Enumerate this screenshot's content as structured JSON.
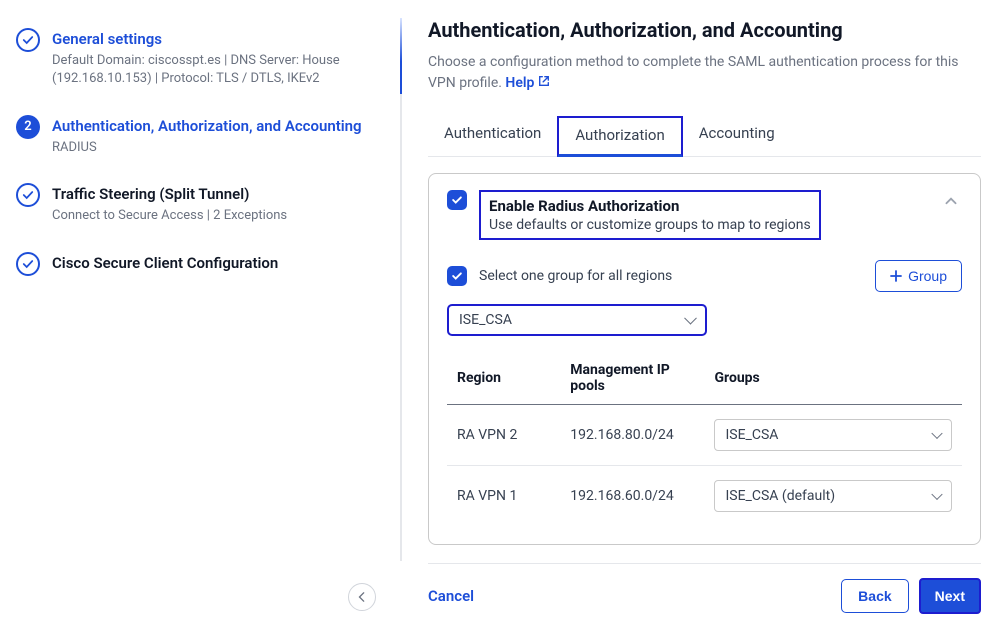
{
  "sidebar": {
    "steps": [
      {
        "title": "General settings",
        "sub": "Default Domain: ciscosspt.es | DNS Server: House (192.168.10.153) | Protocol: TLS / DTLS, IKEv2"
      },
      {
        "title": "Authentication, Authorization, and Accounting",
        "sub": "RADIUS",
        "num": "2"
      },
      {
        "title": "Traffic Steering (Split Tunnel)",
        "sub": "Connect to Secure Access | 2 Exceptions"
      },
      {
        "title": "Cisco Secure Client Configuration",
        "sub": ""
      }
    ]
  },
  "main": {
    "title": "Authentication, Authorization, and Accounting",
    "desc": "Choose a configuration method to complete the SAML authentication process for this VPN profile.",
    "help": "Help",
    "tabs": {
      "auth": "Authentication",
      "authz": "Authorization",
      "acct": "Accounting"
    },
    "panel": {
      "enable_title": "Enable Radius Authorization",
      "enable_sub": "Use defaults or customize groups to map to regions",
      "select_one": "Select one group for all regions",
      "add_group": "Group",
      "top_select": "ISE_CSA",
      "th": {
        "region": "Region",
        "pools": "Management IP pools",
        "groups": "Groups"
      },
      "rows": [
        {
          "region": "RA VPN 2",
          "pool": "192.168.80.0/24",
          "group": "ISE_CSA"
        },
        {
          "region": "RA VPN 1",
          "pool": "192.168.60.0/24",
          "group": "ISE_CSA (default)"
        }
      ]
    }
  },
  "footer": {
    "cancel": "Cancel",
    "back": "Back",
    "next": "Next"
  }
}
